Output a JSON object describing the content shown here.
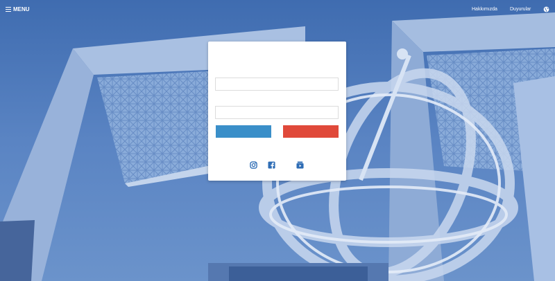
{
  "topbar": {
    "menu_label": "MENU",
    "links": [
      {
        "label": "Hakkımızda"
      },
      {
        "label": "Duyurular"
      }
    ],
    "language_icon": "globe-icon"
  },
  "login": {
    "username_value": "",
    "password_value": "",
    "primary_button_label": "",
    "secondary_button_label": "",
    "primary_color": "#3a8fc9",
    "secondary_color": "#e0493a"
  },
  "social": [
    {
      "icon": "instagram-icon"
    },
    {
      "icon": "facebook-icon"
    },
    {
      "icon": "youtube-icon"
    }
  ],
  "theme": {
    "overlay_color": "#4f78b8"
  }
}
